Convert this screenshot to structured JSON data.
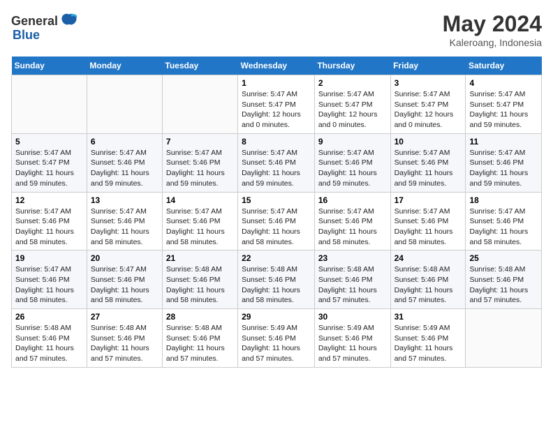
{
  "header": {
    "logo_general": "General",
    "logo_blue": "Blue",
    "month": "May 2024",
    "location": "Kaleroang, Indonesia"
  },
  "days_of_week": [
    "Sunday",
    "Monday",
    "Tuesday",
    "Wednesday",
    "Thursday",
    "Friday",
    "Saturday"
  ],
  "weeks": [
    [
      {
        "day": "",
        "info": ""
      },
      {
        "day": "",
        "info": ""
      },
      {
        "day": "",
        "info": ""
      },
      {
        "day": "1",
        "info": "Sunrise: 5:47 AM\nSunset: 5:47 PM\nDaylight: 12 hours\nand 0 minutes."
      },
      {
        "day": "2",
        "info": "Sunrise: 5:47 AM\nSunset: 5:47 PM\nDaylight: 12 hours\nand 0 minutes."
      },
      {
        "day": "3",
        "info": "Sunrise: 5:47 AM\nSunset: 5:47 PM\nDaylight: 12 hours\nand 0 minutes."
      },
      {
        "day": "4",
        "info": "Sunrise: 5:47 AM\nSunset: 5:47 PM\nDaylight: 11 hours\nand 59 minutes."
      }
    ],
    [
      {
        "day": "5",
        "info": "Sunrise: 5:47 AM\nSunset: 5:47 PM\nDaylight: 11 hours\nand 59 minutes."
      },
      {
        "day": "6",
        "info": "Sunrise: 5:47 AM\nSunset: 5:46 PM\nDaylight: 11 hours\nand 59 minutes."
      },
      {
        "day": "7",
        "info": "Sunrise: 5:47 AM\nSunset: 5:46 PM\nDaylight: 11 hours\nand 59 minutes."
      },
      {
        "day": "8",
        "info": "Sunrise: 5:47 AM\nSunset: 5:46 PM\nDaylight: 11 hours\nand 59 minutes."
      },
      {
        "day": "9",
        "info": "Sunrise: 5:47 AM\nSunset: 5:46 PM\nDaylight: 11 hours\nand 59 minutes."
      },
      {
        "day": "10",
        "info": "Sunrise: 5:47 AM\nSunset: 5:46 PM\nDaylight: 11 hours\nand 59 minutes."
      },
      {
        "day": "11",
        "info": "Sunrise: 5:47 AM\nSunset: 5:46 PM\nDaylight: 11 hours\nand 59 minutes."
      }
    ],
    [
      {
        "day": "12",
        "info": "Sunrise: 5:47 AM\nSunset: 5:46 PM\nDaylight: 11 hours\nand 58 minutes."
      },
      {
        "day": "13",
        "info": "Sunrise: 5:47 AM\nSunset: 5:46 PM\nDaylight: 11 hours\nand 58 minutes."
      },
      {
        "day": "14",
        "info": "Sunrise: 5:47 AM\nSunset: 5:46 PM\nDaylight: 11 hours\nand 58 minutes."
      },
      {
        "day": "15",
        "info": "Sunrise: 5:47 AM\nSunset: 5:46 PM\nDaylight: 11 hours\nand 58 minutes."
      },
      {
        "day": "16",
        "info": "Sunrise: 5:47 AM\nSunset: 5:46 PM\nDaylight: 11 hours\nand 58 minutes."
      },
      {
        "day": "17",
        "info": "Sunrise: 5:47 AM\nSunset: 5:46 PM\nDaylight: 11 hours\nand 58 minutes."
      },
      {
        "day": "18",
        "info": "Sunrise: 5:47 AM\nSunset: 5:46 PM\nDaylight: 11 hours\nand 58 minutes."
      }
    ],
    [
      {
        "day": "19",
        "info": "Sunrise: 5:47 AM\nSunset: 5:46 PM\nDaylight: 11 hours\nand 58 minutes."
      },
      {
        "day": "20",
        "info": "Sunrise: 5:47 AM\nSunset: 5:46 PM\nDaylight: 11 hours\nand 58 minutes."
      },
      {
        "day": "21",
        "info": "Sunrise: 5:48 AM\nSunset: 5:46 PM\nDaylight: 11 hours\nand 58 minutes."
      },
      {
        "day": "22",
        "info": "Sunrise: 5:48 AM\nSunset: 5:46 PM\nDaylight: 11 hours\nand 58 minutes."
      },
      {
        "day": "23",
        "info": "Sunrise: 5:48 AM\nSunset: 5:46 PM\nDaylight: 11 hours\nand 57 minutes."
      },
      {
        "day": "24",
        "info": "Sunrise: 5:48 AM\nSunset: 5:46 PM\nDaylight: 11 hours\nand 57 minutes."
      },
      {
        "day": "25",
        "info": "Sunrise: 5:48 AM\nSunset: 5:46 PM\nDaylight: 11 hours\nand 57 minutes."
      }
    ],
    [
      {
        "day": "26",
        "info": "Sunrise: 5:48 AM\nSunset: 5:46 PM\nDaylight: 11 hours\nand 57 minutes."
      },
      {
        "day": "27",
        "info": "Sunrise: 5:48 AM\nSunset: 5:46 PM\nDaylight: 11 hours\nand 57 minutes."
      },
      {
        "day": "28",
        "info": "Sunrise: 5:48 AM\nSunset: 5:46 PM\nDaylight: 11 hours\nand 57 minutes."
      },
      {
        "day": "29",
        "info": "Sunrise: 5:49 AM\nSunset: 5:46 PM\nDaylight: 11 hours\nand 57 minutes."
      },
      {
        "day": "30",
        "info": "Sunrise: 5:49 AM\nSunset: 5:46 PM\nDaylight: 11 hours\nand 57 minutes."
      },
      {
        "day": "31",
        "info": "Sunrise: 5:49 AM\nSunset: 5:46 PM\nDaylight: 11 hours\nand 57 minutes."
      },
      {
        "day": "",
        "info": ""
      }
    ]
  ]
}
